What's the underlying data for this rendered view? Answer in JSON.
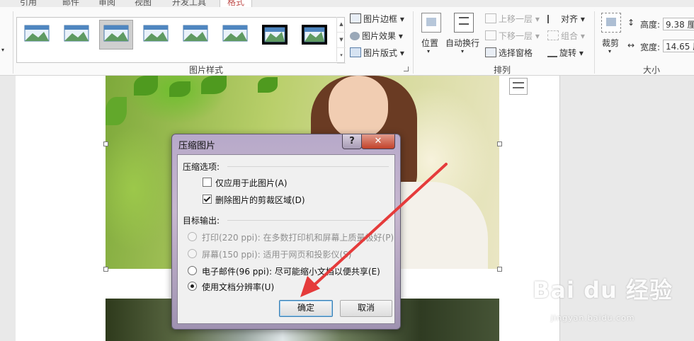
{
  "tabs": [
    "引用",
    "邮件",
    "审阅",
    "视图",
    "开发工具",
    "格式"
  ],
  "ribbon": {
    "style_gallery_count": 8,
    "picture_styles_group": {
      "label": "图片样式",
      "border": "图片边框",
      "effects": "图片效果",
      "layout": "图片版式"
    },
    "arrange_group": {
      "label": "排列",
      "position": "位置",
      "wrap_text": "自动换行",
      "bring_forward": "上移一层",
      "send_backward": "下移一层",
      "selection_pane": "选择窗格",
      "align": "对齐",
      "group": "组合",
      "rotate": "旋转"
    },
    "size_group": {
      "label": "大小",
      "crop": "裁剪",
      "height_label": "高度:",
      "height_value": "9.38 厘",
      "width_label": "宽度:",
      "width_value": "14.65 厘"
    }
  },
  "dialog": {
    "title": "压缩图片",
    "help": "?",
    "compress_options_label": "压缩选项:",
    "apply_only_this": {
      "label": "仅应用于此图片(A)",
      "checked": false
    },
    "delete_cropped": {
      "label": "删除图片的剪裁区域(D)",
      "checked": true
    },
    "target_output_label": "目标输出:",
    "outputs": [
      {
        "label": "打印(220 ppi): 在多数打印机和屏幕上质量极好(P)",
        "enabled": false,
        "selected": false
      },
      {
        "label": "屏幕(150 ppi): 适用于网页和投影仪(S)",
        "enabled": false,
        "selected": false
      },
      {
        "label": "电子邮件(96 ppi): 尽可能缩小文档以便共享(E)",
        "enabled": true,
        "selected": false
      },
      {
        "label": "使用文档分辨率(U)",
        "enabled": true,
        "selected": true
      }
    ],
    "ok_label": "确定",
    "cancel_label": "取消"
  },
  "watermark": {
    "main": "Bai du 经验",
    "sub": "jingyan.baidu.com"
  },
  "colors": {
    "arrow": "#e53b3b",
    "accent_tab": "#c0504d",
    "dialog_frame": "#b7a9c9"
  }
}
